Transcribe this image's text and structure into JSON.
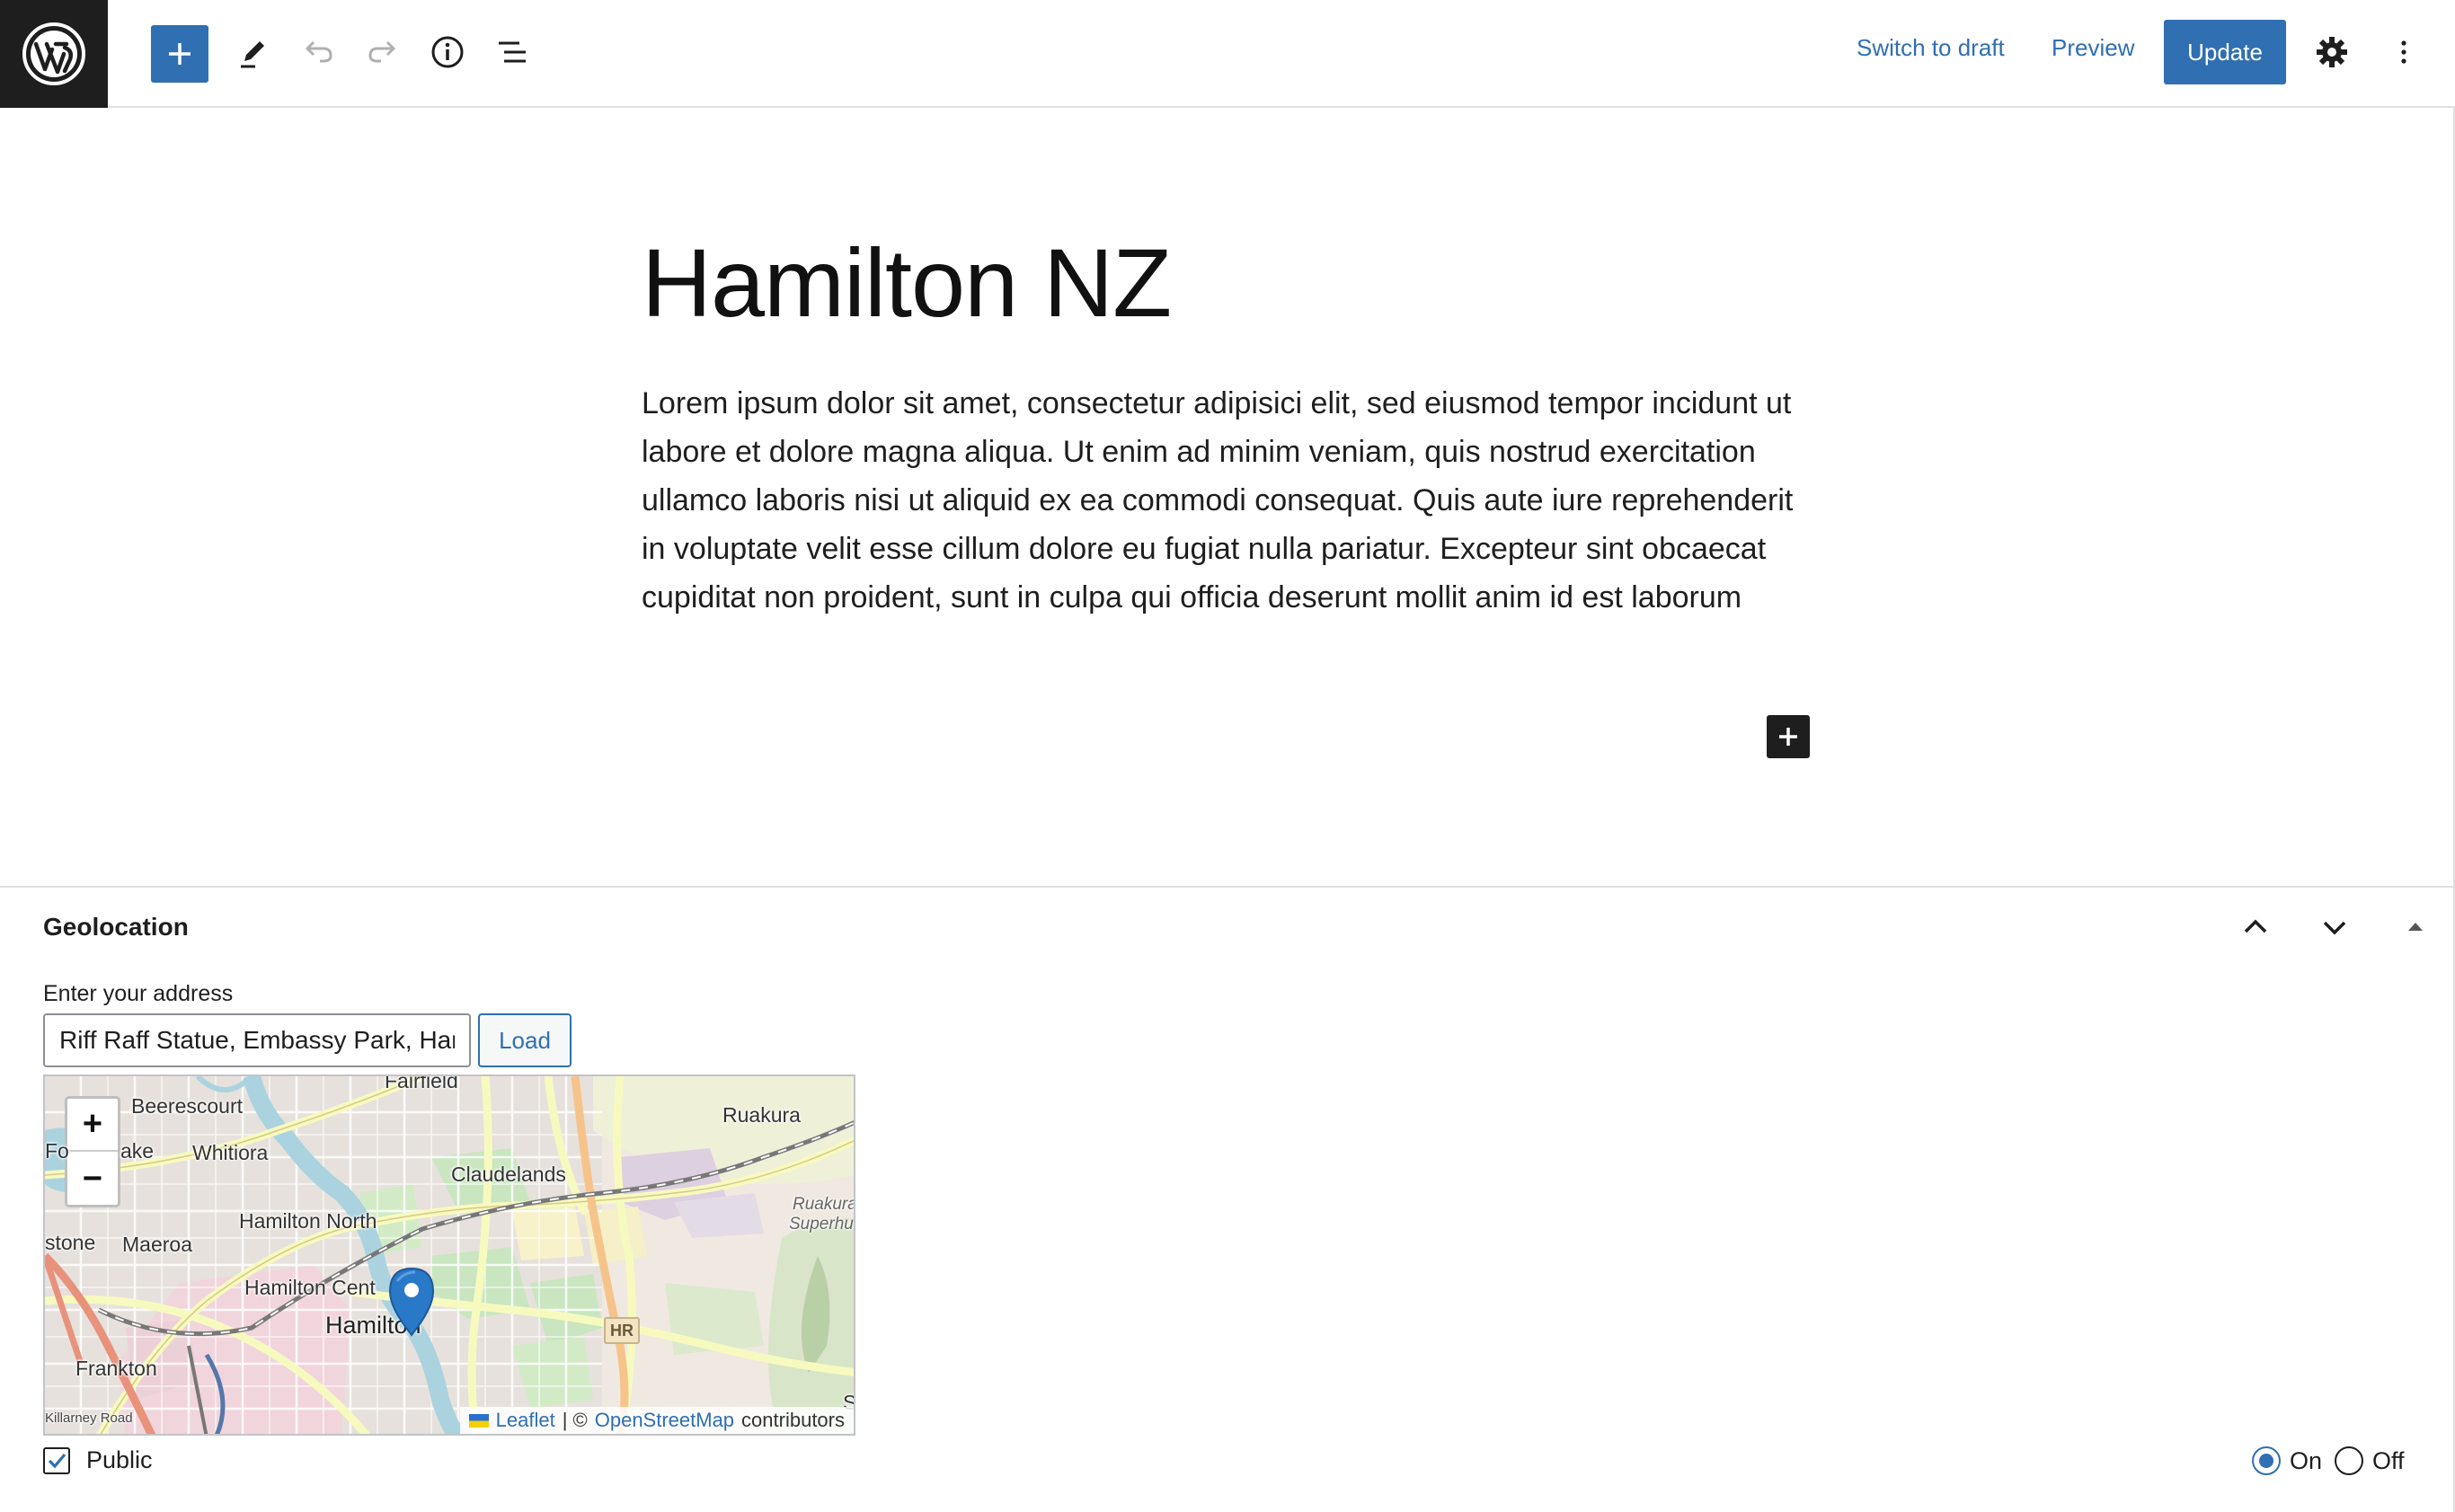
{
  "toolbar": {
    "logo_icon": "wordpress-logo-icon",
    "add_block_icon": "plus-icon",
    "tools_icon": "pencil-icon",
    "undo_icon": "undo-icon",
    "redo_icon": "redo-icon",
    "details_icon": "info-icon",
    "list_view_icon": "list-view-icon",
    "switch_to_draft": "Switch to draft",
    "preview": "Preview",
    "update": "Update",
    "settings_icon": "gear-icon",
    "options_icon": "more-vertical-icon"
  },
  "post": {
    "title": "Hamilton NZ",
    "body": "Lorem ipsum dolor sit amet, consectetur adipisici elit, sed eiusmod tempor incidunt ut labore et dolore magna aliqua. Ut enim ad minim veniam, quis nostrud exercitation ullamco laboris nisi ut aliquid ex ea commodi consequat. Quis aute iure reprehenderit in voluptate velit esse cillum dolore eu fugiat nulla pariatur. Excepteur sint obcaecat cupiditat non proident, sunt in culpa qui officia deserunt mollit anim id est laborum",
    "inline_add_icon": "plus-icon"
  },
  "geolocation": {
    "title": "Geolocation",
    "move_up_icon": "chevron-up-icon",
    "move_down_icon": "chevron-down-icon",
    "toggle_icon": "caret-up-icon",
    "address_label": "Enter your address",
    "address_value": "Riff Raff Statue, Embassy Park, Hamilton",
    "load_button": "Load",
    "map": {
      "zoom_in": "+",
      "zoom_out": "−",
      "labels": {
        "fairfield": "Fairfield",
        "beerescourt": "Beerescourt",
        "forest_lake": "Fo",
        "lake": "ake",
        "whitiora": "Whitiora",
        "claudelands": "Claudelands",
        "ruakura": "Ruakura",
        "ruakura_superhub_1": "Ruakura",
        "ruakura_superhub_2": "Superhu",
        "hamilton_north": "Hamilton North",
        "stone": "stone",
        "maeroa": "Maeroa",
        "hamilton_central": "Hamilton Cent",
        "hamilton": "Hamilton",
        "frankton": "Frankton",
        "killarney_road": "Killarney Road",
        "hr": "HR",
        "edge_s": "S"
      },
      "attribution": {
        "leaflet": "Leaflet",
        "separator": "| ©",
        "osm": "OpenStreetMap",
        "contributors": "contributors"
      }
    },
    "public_label": "Public",
    "public_checked": true,
    "on_label": "On",
    "off_label": "Off",
    "selected": "On"
  },
  "colors": {
    "accent": "#2f6fb2",
    "dark": "#1e1e1e"
  }
}
